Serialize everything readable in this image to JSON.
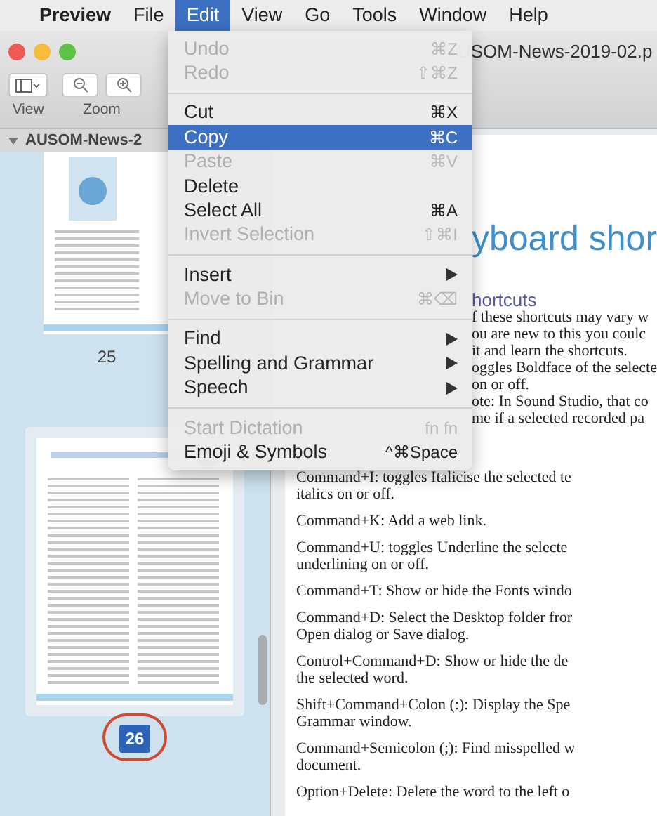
{
  "menu_bar": [
    {
      "label": "Preview",
      "selected": false,
      "bold": true
    },
    {
      "label": "File",
      "selected": false,
      "bold": false
    },
    {
      "label": "Edit",
      "selected": true,
      "bold": false
    },
    {
      "label": "View",
      "selected": false,
      "bold": false
    },
    {
      "label": "Go",
      "selected": false,
      "bold": false
    },
    {
      "label": "Tools",
      "selected": false,
      "bold": false
    },
    {
      "label": "Window",
      "selected": false,
      "bold": false
    },
    {
      "label": "Help",
      "selected": false,
      "bold": false
    }
  ],
  "window": {
    "title": "USOM-News-2019-02.p",
    "toolbar": [
      {
        "label": "View",
        "kind": "sidebar"
      },
      {
        "label": "Zoom",
        "kind": "zoom"
      }
    ]
  },
  "sidebar": {
    "header": "AUSOM-News-2",
    "expanded": true,
    "pages": [
      {
        "number": "25",
        "selected": false
      },
      {
        "number": "26",
        "selected": true
      }
    ]
  },
  "document": {
    "heading": "yboard shor",
    "subheading": "hortcuts",
    "covered_lines": [
      "f these shortcuts may vary w",
      "ou are new to this you coulc",
      "it and learn the shortcuts.",
      "oggles Boldface of the selecte",
      "on or off.",
      "ote: In Sound Studio, that co",
      "me if a selected recorded pa"
    ],
    "paragraphs": [
      [
        "Command+I: toggles Italicise the selected te",
        "italics on or off."
      ],
      [
        "Command+K: Add a web link."
      ],
      [
        "Command+U: toggles Underline the selecte",
        "underlining on or off."
      ],
      [
        "Command+T: Show or hide the Fonts windo"
      ],
      [
        "Command+D: Select the Desktop folder fror",
        "Open dialog or Save dialog."
      ],
      [
        "Control+Command+D: Show or hide the de",
        "the selected word."
      ],
      [
        "Shift+Command+Colon (:): Display the Spe",
        "Grammar window."
      ],
      [
        "Command+Semicolon (;): Find misspelled w",
        "document."
      ],
      [
        "Option+Delete: Delete the word to the left o"
      ]
    ]
  },
  "edit_menu": {
    "groups": [
      [
        {
          "label": "Undo",
          "shortcut": "⌘Z",
          "disabled": true,
          "selected": false,
          "submenu": false
        },
        {
          "label": "Redo",
          "shortcut": "⇧⌘Z",
          "disabled": true,
          "selected": false,
          "submenu": false
        }
      ],
      [
        {
          "label": "Cut",
          "shortcut": "⌘X",
          "disabled": false,
          "selected": false,
          "submenu": false
        },
        {
          "label": "Copy",
          "shortcut": "⌘C",
          "disabled": false,
          "selected": true,
          "submenu": false
        },
        {
          "label": "Paste",
          "shortcut": "⌘V",
          "disabled": true,
          "selected": false,
          "submenu": false
        },
        {
          "label": "Delete",
          "disabled": false,
          "selected": false,
          "submenu": false
        },
        {
          "label": "Select All",
          "shortcut": "⌘A",
          "disabled": false,
          "selected": false,
          "submenu": false
        },
        {
          "label": "Invert Selection",
          "shortcut": "⇧⌘I",
          "disabled": true,
          "selected": false,
          "submenu": false
        }
      ],
      [
        {
          "label": "Insert",
          "disabled": false,
          "selected": false,
          "submenu": true
        },
        {
          "label": "Move to Bin",
          "shortcut": "⌘⌫",
          "disabled": true,
          "selected": false,
          "submenu": false
        }
      ],
      [
        {
          "label": "Find",
          "disabled": false,
          "selected": false,
          "submenu": true
        },
        {
          "label": "Spelling and Grammar",
          "disabled": false,
          "selected": false,
          "submenu": true
        },
        {
          "label": "Speech",
          "disabled": false,
          "selected": false,
          "submenu": true
        }
      ],
      [
        {
          "label": "Start Dictation",
          "shortcut": "fn fn",
          "disabled": true,
          "selected": false,
          "submenu": false
        },
        {
          "label": "Emoji & Symbols",
          "shortcut": "^⌘Space",
          "disabled": false,
          "selected": false,
          "submenu": false
        }
      ]
    ]
  }
}
